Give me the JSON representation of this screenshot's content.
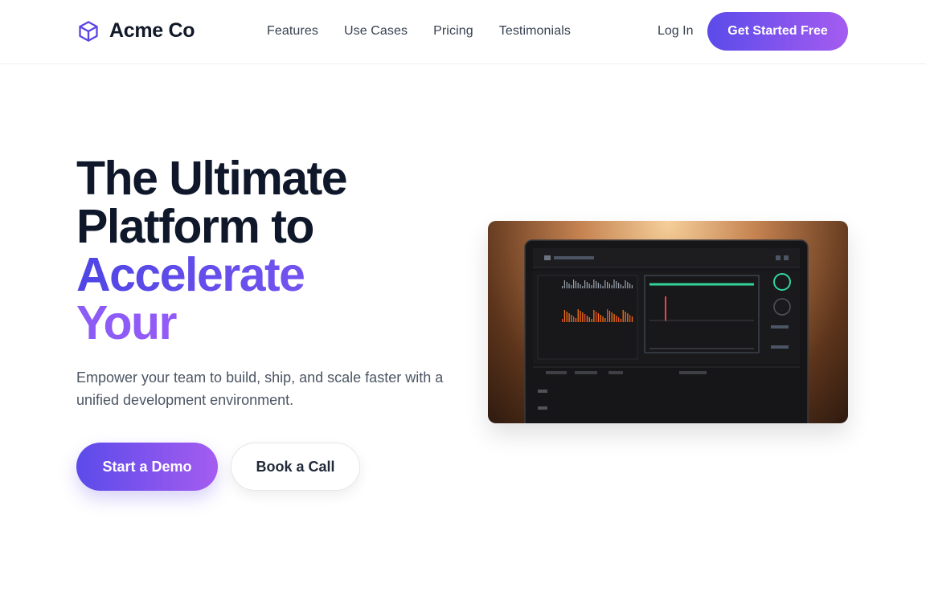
{
  "brand": {
    "name": "Acme Co",
    "logo_icon": "cube-icon"
  },
  "nav": {
    "links": [
      "Features",
      "Use Cases",
      "Pricing",
      "Testimonials"
    ],
    "login": "Log In",
    "cta": "Get Started Free"
  },
  "hero": {
    "title_lines": [
      "The Ultimate",
      "Platform to",
      "Accelerate",
      "Your"
    ],
    "subtitle": "Empower your team to build, ship, and scale faster with a unified development environment.",
    "primary_button": "Start a Demo",
    "secondary_button": "Book a Call"
  },
  "colors": {
    "accent_start": "#5b4bea",
    "accent_end": "#a55cf0",
    "text_dark": "#0f172a"
  }
}
